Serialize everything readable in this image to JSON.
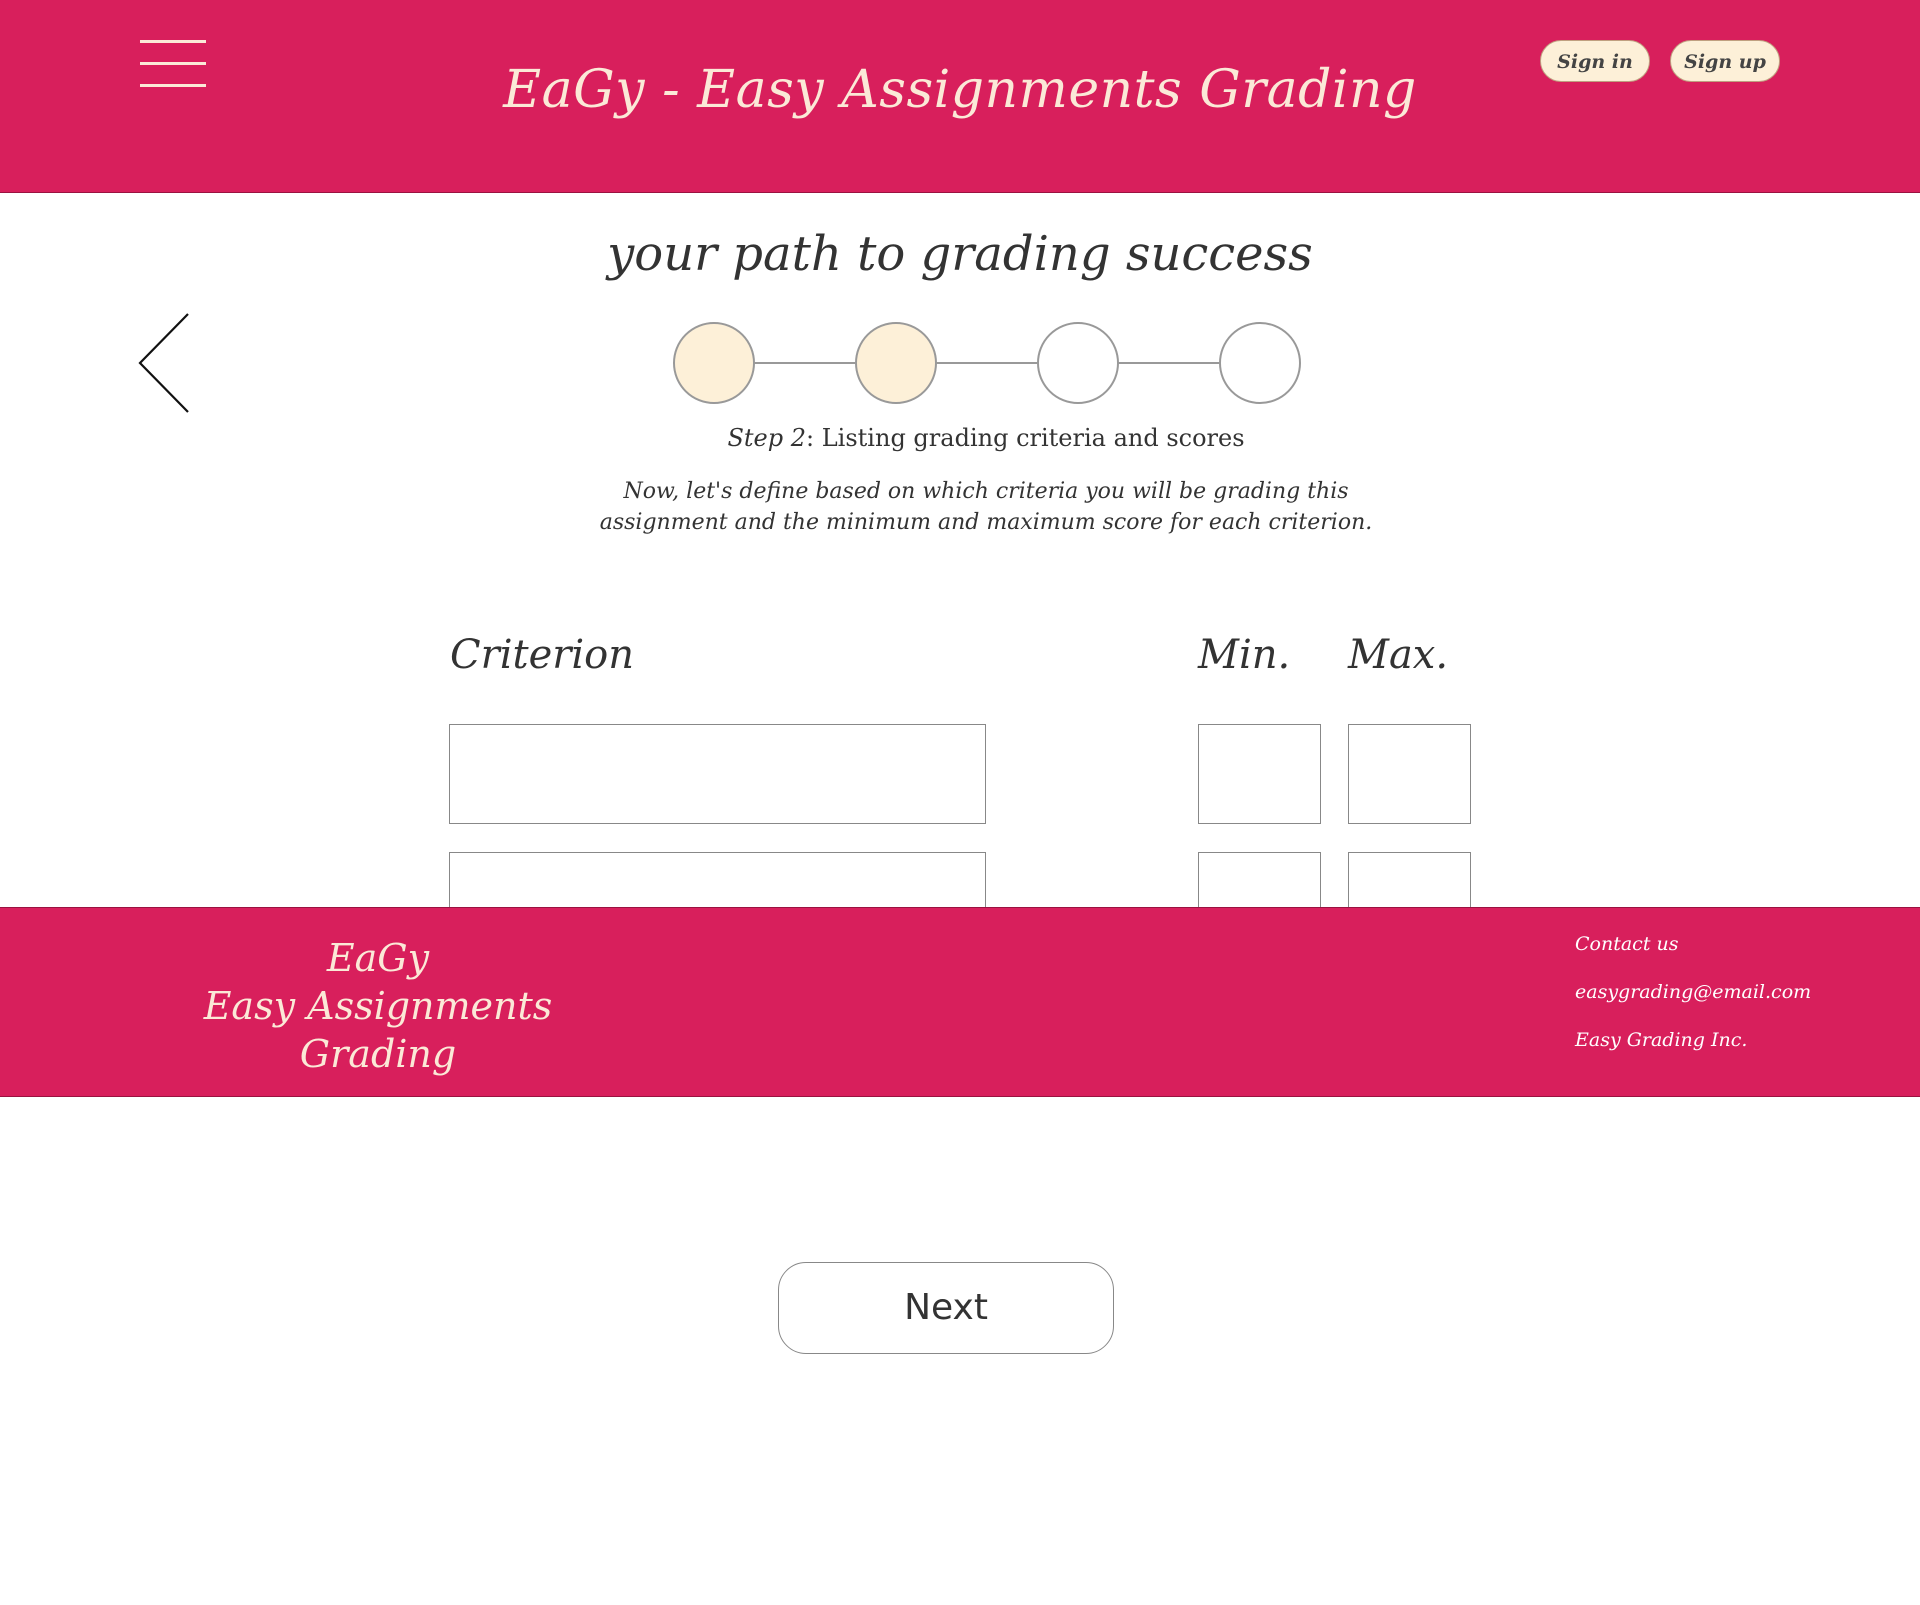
{
  "header": {
    "title": "EaGy - Easy Assignments Grading",
    "sign_in": "Sign in",
    "sign_up": "Sign up",
    "menu_icon": "hamburger-menu-icon",
    "brand_color": "#d81f5c",
    "accent_color": "#fdf0d8"
  },
  "main": {
    "tagline": "your path to grading success",
    "back_icon": "chevron-left-icon",
    "stepper": {
      "total_steps": 4,
      "completed_steps": 2,
      "current_step": 2
    },
    "step_label_prefix": "Step 2",
    "step_label_text": ": Listing grading criteria and scores",
    "description": "Now, let's define based on which criteria you will be grading this assignment and the minimum and maximum score for each criterion.",
    "columns": {
      "criterion": "Criterion",
      "min": "Min.",
      "max": "Max."
    },
    "rows": [
      {
        "criterion": "",
        "min": "",
        "max": ""
      },
      {
        "criterion": "",
        "min": "",
        "max": ""
      }
    ]
  },
  "footer": {
    "brand_line1": "EaGy",
    "brand_line2": "Easy Assignments Grading",
    "contact": "Contact us",
    "email": "easygrading@email.com",
    "company": "Easy Grading Inc."
  },
  "actions": {
    "next_label": "Next"
  }
}
